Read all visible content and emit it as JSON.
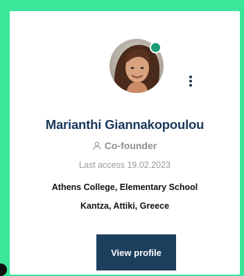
{
  "profile": {
    "name": "Marianthi Giannakopoulou",
    "role": "Co-founder",
    "last_access": "Last access 19.02.2023",
    "organization": "Athens College, Elementary School",
    "location": "Kantza, Attiki, Greece",
    "online": true
  },
  "actions": {
    "view_profile_label": "View profile",
    "more_menu_icon": "kebab-vertical-icon"
  },
  "colors": {
    "page_background": "#3be59a",
    "card_background": "#ffffff",
    "name_color": "#1c3a5c",
    "button_background": "#1d3f5e",
    "status_dot": "#1e9b76"
  }
}
